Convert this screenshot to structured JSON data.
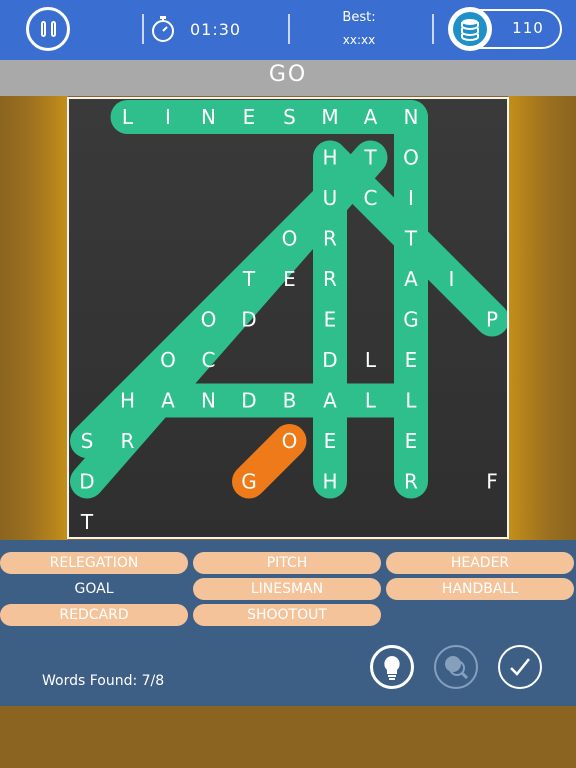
{
  "header": {
    "timer": "01:30",
    "best_label": "Best:",
    "best_value": "xx:xx",
    "coins": "110"
  },
  "current_word": "GO",
  "grid": {
    "letters": [
      {
        "ch": "L",
        "r": 0,
        "c": 1
      },
      {
        "ch": "I",
        "r": 0,
        "c": 2
      },
      {
        "ch": "N",
        "r": 0,
        "c": 3
      },
      {
        "ch": "E",
        "r": 0,
        "c": 4
      },
      {
        "ch": "S",
        "r": 0,
        "c": 5
      },
      {
        "ch": "M",
        "r": 0,
        "c": 6
      },
      {
        "ch": "A",
        "r": 0,
        "c": 7
      },
      {
        "ch": "N",
        "r": 0,
        "c": 8
      },
      {
        "ch": "H",
        "r": 1,
        "c": 6
      },
      {
        "ch": "T",
        "r": 1,
        "c": 7
      },
      {
        "ch": "O",
        "r": 1,
        "c": 8
      },
      {
        "ch": "U",
        "r": 2,
        "c": 6
      },
      {
        "ch": "C",
        "r": 2,
        "c": 7
      },
      {
        "ch": "I",
        "r": 2,
        "c": 8
      },
      {
        "ch": "O",
        "r": 3,
        "c": 5
      },
      {
        "ch": "R",
        "r": 3,
        "c": 6
      },
      {
        "ch": "T",
        "r": 3,
        "c": 8
      },
      {
        "ch": "T",
        "r": 4,
        "c": 4
      },
      {
        "ch": "E",
        "r": 4,
        "c": 5
      },
      {
        "ch": "R",
        "r": 4,
        "c": 6
      },
      {
        "ch": "A",
        "r": 4,
        "c": 8
      },
      {
        "ch": "I",
        "r": 4,
        "c": 9
      },
      {
        "ch": "O",
        "r": 5,
        "c": 3
      },
      {
        "ch": "D",
        "r": 5,
        "c": 4
      },
      {
        "ch": "E",
        "r": 5,
        "c": 6
      },
      {
        "ch": "G",
        "r": 5,
        "c": 8
      },
      {
        "ch": "P",
        "r": 5,
        "c": 10
      },
      {
        "ch": "O",
        "r": 6,
        "c": 2
      },
      {
        "ch": "C",
        "r": 6,
        "c": 3
      },
      {
        "ch": "D",
        "r": 6,
        "c": 6
      },
      {
        "ch": "L",
        "r": 6,
        "c": 7
      },
      {
        "ch": "E",
        "r": 6,
        "c": 8
      },
      {
        "ch": "H",
        "r": 7,
        "c": 1
      },
      {
        "ch": "A",
        "r": 7,
        "c": 2
      },
      {
        "ch": "N",
        "r": 7,
        "c": 3
      },
      {
        "ch": "D",
        "r": 7,
        "c": 4
      },
      {
        "ch": "B",
        "r": 7,
        "c": 5
      },
      {
        "ch": "A",
        "r": 7,
        "c": 6
      },
      {
        "ch": "L",
        "r": 7,
        "c": 7
      },
      {
        "ch": "L",
        "r": 7,
        "c": 8
      },
      {
        "ch": "S",
        "r": 8,
        "c": 0
      },
      {
        "ch": "R",
        "r": 8,
        "c": 1
      },
      {
        "ch": "O",
        "r": 8,
        "c": 5
      },
      {
        "ch": "E",
        "r": 8,
        "c": 6
      },
      {
        "ch": "E",
        "r": 8,
        "c": 8
      },
      {
        "ch": "D",
        "r": 9,
        "c": 0
      },
      {
        "ch": "G",
        "r": 9,
        "c": 4
      },
      {
        "ch": "H",
        "r": 9,
        "c": 6
      },
      {
        "ch": "R",
        "r": 9,
        "c": 8
      },
      {
        "ch": "F",
        "r": 9,
        "c": 10
      },
      {
        "ch": "T",
        "r": 10,
        "c": 0
      }
    ],
    "found_paths": [
      {
        "word": "LINESMAN",
        "from": [
          0,
          1
        ],
        "to": [
          0,
          8
        ]
      },
      {
        "word": "RELEGATION",
        "from": [
          9,
          8
        ],
        "to": [
          0,
          8
        ]
      },
      {
        "word": "HEADER",
        "from": [
          9,
          6
        ],
        "to": [
          4,
          6
        ]
      },
      {
        "word": "PITCH",
        "from": [
          5,
          10
        ],
        "to": [
          1,
          6
        ]
      },
      {
        "word": "HANDBALL",
        "from": [
          7,
          1
        ],
        "to": [
          7,
          8
        ]
      },
      {
        "word": "REDCARD",
        "from": [
          4,
          6
        ],
        "to": [
          1,
          6
        ]
      },
      {
        "word": "SHOOTOUT",
        "from": [
          8,
          0
        ],
        "to": [
          2,
          6
        ]
      },
      {
        "word": "diag",
        "from": [
          9,
          0
        ],
        "to": [
          1,
          7
        ]
      }
    ],
    "selection": {
      "from": [
        9,
        4
      ],
      "to": [
        8,
        5
      ]
    },
    "colors": {
      "found": "#2fbf8c",
      "selection": "#ef7a1a",
      "letter": "#ffffff"
    }
  },
  "words": [
    {
      "label": "RELEGATION",
      "found": true
    },
    {
      "label": "PITCH",
      "found": true
    },
    {
      "label": "HEADER",
      "found": true
    },
    {
      "label": "GOAL",
      "found": false
    },
    {
      "label": "LINESMAN",
      "found": true
    },
    {
      "label": "HANDBALL",
      "found": true
    },
    {
      "label": "REDCARD",
      "found": true
    },
    {
      "label": "SHOOTOUT",
      "found": true
    }
  ],
  "footer": {
    "words_found": "Words Found: 7/8"
  },
  "icons": {
    "pause": "pause-icon",
    "timer": "stopwatch-icon",
    "coins": "coin-stack-icon",
    "hint": "lightbulb-icon",
    "reveal": "magnifier-icon",
    "check": "checkmark-icon"
  }
}
